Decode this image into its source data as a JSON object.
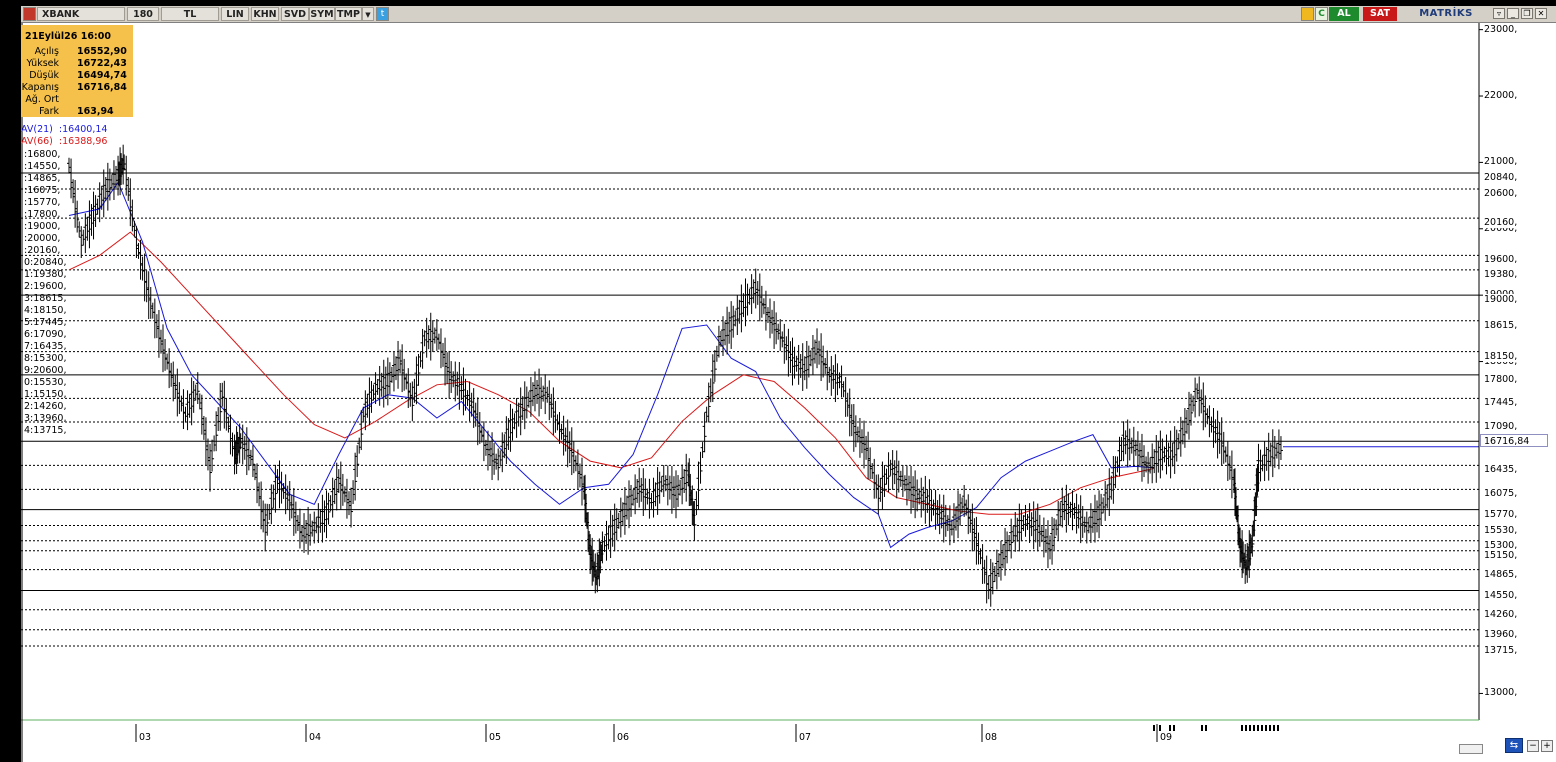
{
  "toolbar": {
    "symbol": "XBANK",
    "period": "180",
    "currency": "TL",
    "buttons": [
      "LIN",
      "KHN",
      "SVD",
      "SYM",
      "TMP"
    ],
    "buy": "AL",
    "sell": "SAT",
    "brand": "MATRİKS",
    "colors": {
      "buy": "#1e8a2e",
      "sell": "#c81818",
      "brand": "#1f3b7a"
    }
  },
  "infobox": {
    "title": "21Eylül26 16:00",
    "rows": [
      {
        "label": "Açılış",
        "value": "16552,90"
      },
      {
        "label": "Yüksek",
        "value": "16722,43"
      },
      {
        "label": "Düşük",
        "value": "16494,74"
      },
      {
        "label": "Kapanış",
        "value": "16716,84"
      },
      {
        "label": "Ağ. Ort",
        "value": ""
      },
      {
        "label": "Fark",
        "value": "163,94"
      }
    ],
    "bg_color": "#f5c14b"
  },
  "indicators": [
    {
      "label": "AV(21)",
      "value": ":16400,14",
      "color": "#1a1ad8"
    },
    {
      "label": "AV(66)",
      "value": ":16388,96",
      "color": "#d81a1a"
    }
  ],
  "level_list": [
    ":16800,",
    ":14550,",
    ":14865,",
    ":16075,",
    ":15770,",
    ":17800,",
    ":19000,",
    ":20000,",
    ":20160,",
    "0:20840,",
    "1:19380,",
    "2:19600,",
    "3:18615,",
    "4:18150,",
    "5:17445,",
    "6:17090,",
    "7:16435,",
    "8:15300,",
    "9:20600,",
    "0:15530,",
    "1:15150,",
    "2:14260,",
    "3:13960,",
    "4:13715,"
  ],
  "right_axis_ticks": [
    "23000,",
    "22000,",
    "21000,",
    "20000,",
    "19000,",
    "18000,",
    "13000,"
  ],
  "right_axis_levels": [
    "20840,",
    "20600,",
    "20160,",
    "19600,",
    "19380,",
    "19000,",
    "18615,",
    "18150,",
    "17800,",
    "17445,",
    "17090,",
    "16435,",
    "16075,",
    "15770,",
    "15530,",
    "15300,",
    "15150,",
    "14865,",
    "14550,",
    "14260,",
    "13960,",
    "13715,"
  ],
  "current_price": "16716,84",
  "x_ticks": [
    "03",
    "04",
    "05",
    "06",
    "07",
    "08",
    "09"
  ],
  "chart_data": {
    "type": "line",
    "candle_style": "bar",
    "y_range": [
      12600,
      23100
    ],
    "grid": false,
    "solid_levels": [
      20840,
      19000,
      17800,
      16800,
      15770,
      14550
    ],
    "dashed_levels": [
      20600,
      20160,
      19600,
      19380,
      18615,
      18150,
      17445,
      17090,
      16435,
      16075,
      15530,
      15300,
      15150,
      14865,
      14260,
      13960,
      13715
    ],
    "series": [
      {
        "name": "AV(66)",
        "color": "#d81a1a",
        "points": [
          [
            0,
            19380
          ],
          [
            5,
            19600
          ],
          [
            10,
            19950
          ],
          [
            15,
            19500
          ],
          [
            20,
            19000
          ],
          [
            25,
            18500
          ],
          [
            30,
            18000
          ],
          [
            35,
            17500
          ],
          [
            40,
            17050
          ],
          [
            45,
            16850
          ],
          [
            50,
            17100
          ],
          [
            55,
            17400
          ],
          [
            60,
            17650
          ],
          [
            65,
            17700
          ],
          [
            70,
            17500
          ],
          [
            75,
            17250
          ],
          [
            80,
            16800
          ],
          [
            85,
            16500
          ],
          [
            90,
            16400
          ],
          [
            95,
            16550
          ],
          [
            100,
            17100
          ],
          [
            105,
            17500
          ],
          [
            110,
            17800
          ],
          [
            115,
            17700
          ],
          [
            120,
            17300
          ],
          [
            125,
            16850
          ],
          [
            130,
            16250
          ],
          [
            135,
            15950
          ],
          [
            140,
            15850
          ],
          [
            145,
            15750
          ],
          [
            150,
            15700
          ],
          [
            155,
            15700
          ],
          [
            160,
            15850
          ],
          [
            165,
            16100
          ],
          [
            170,
            16250
          ],
          [
            175,
            16350
          ],
          [
            177,
            16390
          ]
        ]
      },
      {
        "name": "AV(21)",
        "color": "#1a1ad8",
        "points": [
          [
            0,
            20200
          ],
          [
            5,
            20300
          ],
          [
            8,
            20700
          ],
          [
            12,
            19800
          ],
          [
            16,
            18500
          ],
          [
            20,
            17800
          ],
          [
            24,
            17400
          ],
          [
            28,
            17000
          ],
          [
            32,
            16500
          ],
          [
            36,
            16000
          ],
          [
            40,
            15850
          ],
          [
            44,
            16600
          ],
          [
            48,
            17300
          ],
          [
            52,
            17500
          ],
          [
            56,
            17450
          ],
          [
            60,
            17150
          ],
          [
            64,
            17400
          ],
          [
            68,
            16950
          ],
          [
            72,
            16500
          ],
          [
            76,
            16150
          ],
          [
            80,
            15850
          ],
          [
            84,
            16100
          ],
          [
            88,
            16150
          ],
          [
            92,
            16600
          ],
          [
            96,
            17500
          ],
          [
            100,
            18500
          ],
          [
            104,
            18550
          ],
          [
            108,
            18050
          ],
          [
            112,
            17850
          ],
          [
            116,
            17150
          ],
          [
            120,
            16700
          ],
          [
            124,
            16300
          ],
          [
            128,
            15950
          ],
          [
            132,
            15700
          ],
          [
            134,
            15200
          ],
          [
            137,
            15400
          ],
          [
            140,
            15500
          ],
          [
            144,
            15600
          ],
          [
            148,
            15800
          ],
          [
            152,
            16250
          ],
          [
            156,
            16500
          ],
          [
            160,
            16650
          ],
          [
            164,
            16800
          ],
          [
            167,
            16900
          ],
          [
            170,
            16400
          ],
          [
            174,
            16420
          ],
          [
            177,
            16400
          ]
        ]
      },
      {
        "name": "",
        "color": "#000000",
        "points": [
          [
            0,
            20950
          ],
          [
            2,
            19800
          ],
          [
            4,
            20200
          ],
          [
            6,
            20600
          ],
          [
            8,
            20800
          ],
          [
            9,
            21000
          ],
          [
            11,
            19800
          ],
          [
            13,
            19000
          ],
          [
            15,
            18300
          ],
          [
            17,
            17700
          ],
          [
            19,
            17200
          ],
          [
            21,
            17600
          ],
          [
            23,
            16400
          ],
          [
            25,
            17500
          ],
          [
            27,
            16600
          ],
          [
            28,
            16800
          ],
          [
            30,
            16500
          ],
          [
            32,
            15500
          ],
          [
            34,
            16200
          ],
          [
            36,
            15900
          ],
          [
            38,
            15400
          ],
          [
            40,
            15500
          ],
          [
            42,
            15700
          ],
          [
            44,
            16200
          ],
          [
            46,
            15800
          ],
          [
            48,
            17200
          ],
          [
            50,
            17600
          ],
          [
            52,
            17700
          ],
          [
            54,
            18000
          ],
          [
            56,
            17400
          ],
          [
            58,
            18350
          ],
          [
            60,
            18400
          ],
          [
            62,
            17800
          ],
          [
            64,
            17600
          ],
          [
            66,
            17300
          ],
          [
            68,
            16700
          ],
          [
            70,
            16450
          ],
          [
            72,
            17000
          ],
          [
            74,
            17300
          ],
          [
            76,
            17550
          ],
          [
            78,
            17500
          ],
          [
            80,
            17000
          ],
          [
            82,
            16650
          ],
          [
            84,
            16100
          ],
          [
            85,
            15100
          ],
          [
            86,
            14750
          ],
          [
            87,
            15200
          ],
          [
            89,
            15500
          ],
          [
            91,
            15800
          ],
          [
            93,
            16100
          ],
          [
            95,
            15900
          ],
          [
            97,
            16200
          ],
          [
            99,
            16000
          ],
          [
            101,
            16300
          ],
          [
            102,
            15600
          ],
          [
            104,
            17200
          ],
          [
            106,
            18300
          ],
          [
            108,
            18550
          ],
          [
            110,
            18850
          ],
          [
            112,
            19100
          ],
          [
            114,
            18700
          ],
          [
            116,
            18400
          ],
          [
            118,
            18000
          ],
          [
            120,
            17900
          ],
          [
            122,
            18200
          ],
          [
            124,
            17800
          ],
          [
            126,
            17700
          ],
          [
            128,
            17000
          ],
          [
            130,
            16700
          ],
          [
            132,
            16000
          ],
          [
            134,
            16400
          ],
          [
            136,
            16200
          ],
          [
            138,
            16000
          ],
          [
            140,
            15900
          ],
          [
            142,
            15700
          ],
          [
            144,
            15500
          ],
          [
            146,
            15900
          ],
          [
            148,
            15300
          ],
          [
            150,
            14600
          ],
          [
            152,
            15000
          ],
          [
            154,
            15400
          ],
          [
            156,
            15600
          ],
          [
            158,
            15500
          ],
          [
            160,
            15200
          ],
          [
            162,
            15800
          ],
          [
            164,
            15750
          ],
          [
            166,
            15500
          ],
          [
            168,
            15700
          ],
          [
            170,
            16100
          ],
          [
            172,
            16800
          ],
          [
            174,
            16700
          ],
          [
            176,
            16400
          ],
          [
            178,
            16600
          ],
          [
            180,
            16600
          ],
          [
            182,
            17000
          ],
          [
            184,
            17550
          ],
          [
            186,
            17100
          ],
          [
            188,
            16800
          ],
          [
            190,
            16200
          ],
          [
            191,
            15200
          ],
          [
            192,
            14900
          ],
          [
            193,
            15300
          ],
          [
            194,
            16400
          ],
          [
            196,
            16600
          ],
          [
            198,
            16716
          ]
        ]
      }
    ]
  }
}
